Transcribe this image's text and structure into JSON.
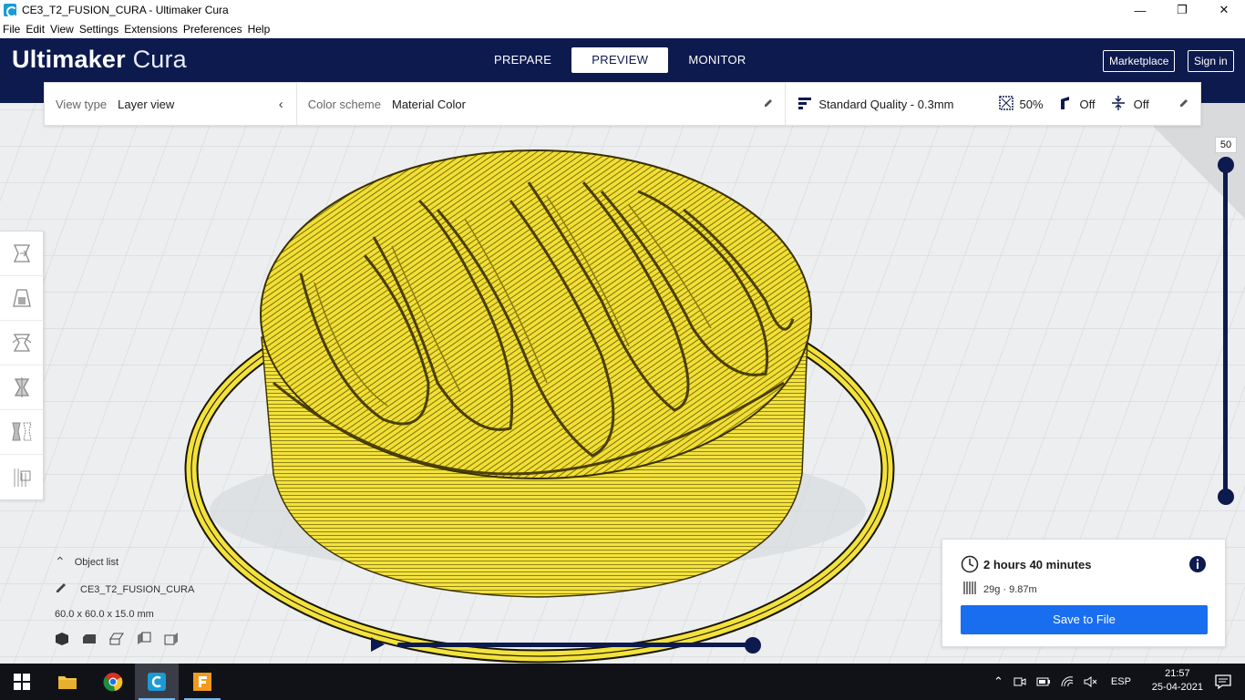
{
  "window": {
    "title": "CE3_T2_FUSION_CURA - Ultimaker Cura",
    "minimize": "—",
    "maximize": "❐",
    "close": "✕"
  },
  "menu": [
    "File",
    "Edit",
    "View",
    "Settings",
    "Extensions",
    "Preferences",
    "Help"
  ],
  "header": {
    "brand_bold": "Ultimaker",
    "brand_light": "Cura",
    "stages": [
      "PREPARE",
      "PREVIEW",
      "MONITOR"
    ],
    "active_stage": "PREVIEW",
    "marketplace": "Marketplace",
    "sign_in": "Sign in"
  },
  "viewbar": {
    "view_type_label": "View type",
    "view_type_value": "Layer view",
    "color_scheme_label": "Color scheme",
    "color_scheme_value": "Material Color",
    "quality": "Standard Quality - 0.3mm",
    "infill": "50%",
    "support": "Off",
    "adhesion": "Off"
  },
  "layer_slider": {
    "current_layer": "50",
    "upper_fraction": 1.0,
    "lower_fraction": 0.0
  },
  "path_slider": {
    "position_fraction": 1.0
  },
  "object_list": {
    "title": "Object list",
    "object_name": "CE3_T2_FUSION_CURA",
    "dimensions": "60.0 x 60.0 x 15.0 mm"
  },
  "print_info": {
    "time": "2 hours 40 minutes",
    "material": "29g · 9.87m",
    "save_button": "Save to File"
  },
  "taskbar": {
    "language": "ESP",
    "time": "21:57",
    "date": "25-04-2021"
  },
  "colors": {
    "header_bg": "#0d1a4e",
    "accent_blue": "#196ef0",
    "filament_yellow": "#f2e03a",
    "filament_dark": "#8a7a10"
  }
}
